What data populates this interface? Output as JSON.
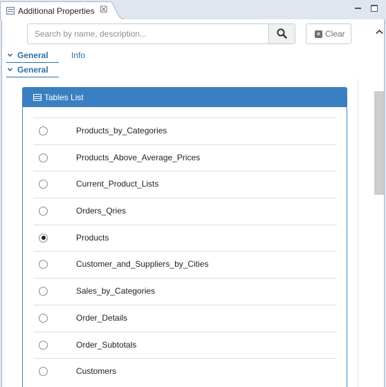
{
  "tab": {
    "title": "Additional Properties",
    "close": "☒"
  },
  "search": {
    "placeholder": "Search by name, description...",
    "value": ""
  },
  "clear": {
    "label": "Clear",
    "icon": "x-icon"
  },
  "sections": {
    "general_primary": "General",
    "info": "Info",
    "general_secondary": "General"
  },
  "tables_list": {
    "title": "Tables List",
    "items": [
      {
        "label": "Products_by_Categories",
        "selected": false
      },
      {
        "label": "Products_Above_Average_Prices",
        "selected": false
      },
      {
        "label": "Current_Product_Lists",
        "selected": false
      },
      {
        "label": "Orders_Qries",
        "selected": false
      },
      {
        "label": "Products",
        "selected": true
      },
      {
        "label": "Customer_and_Suppliers_by_Cities",
        "selected": false
      },
      {
        "label": "Sales_by_Categories",
        "selected": false
      },
      {
        "label": "Order_Details",
        "selected": false
      },
      {
        "label": "Order_Subtotals",
        "selected": false
      },
      {
        "label": "Customers",
        "selected": false
      }
    ]
  },
  "colors": {
    "accent": "#3a7fc1",
    "link": "#2e6da4"
  }
}
